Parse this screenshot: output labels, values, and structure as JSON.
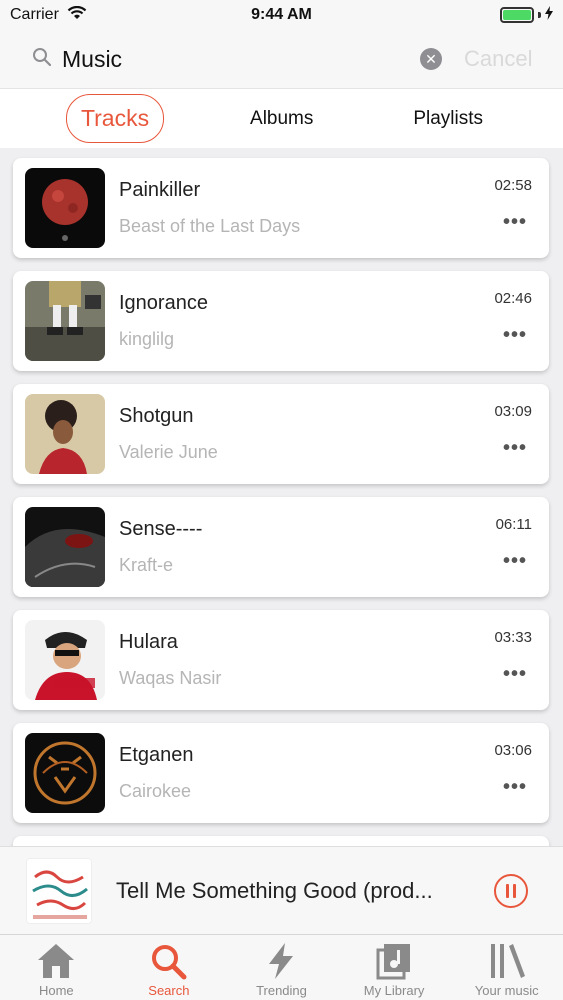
{
  "status_bar": {
    "carrier": "Carrier",
    "time": "9:44 AM"
  },
  "search": {
    "value": "Music",
    "cancel_label": "Cancel"
  },
  "tabs": [
    {
      "label": "Tracks",
      "active": true
    },
    {
      "label": "Albums",
      "active": false
    },
    {
      "label": "Playlists",
      "active": false
    }
  ],
  "tracks": [
    {
      "title": "Painkiller",
      "artist": "Beast of the Last Days",
      "duration": "02:58"
    },
    {
      "title": "Ignorance",
      "artist": "kinglilg",
      "duration": "02:46"
    },
    {
      "title": "Shotgun",
      "artist": "Valerie June",
      "duration": "03:09"
    },
    {
      "title": "Sense----",
      "artist": "Kraft-e",
      "duration": "06:11"
    },
    {
      "title": "Hulara",
      "artist": "Waqas Nasir",
      "duration": "03:33"
    },
    {
      "title": "Etganen",
      "artist": "Cairokee",
      "duration": "03:06"
    }
  ],
  "now_playing": {
    "title": "Tell Me Something Good (prod..."
  },
  "tab_bar": [
    {
      "label": "Home",
      "icon": "home-icon",
      "active": false
    },
    {
      "label": "Search",
      "icon": "search-icon",
      "active": true
    },
    {
      "label": "Trending",
      "icon": "lightning-icon",
      "active": false
    },
    {
      "label": "My Library",
      "icon": "music-library-icon",
      "active": false
    },
    {
      "label": "Your music",
      "icon": "bookshelf-icon",
      "active": false
    }
  ],
  "colors": {
    "accent": "#e8573c",
    "inactive": "#8a8a8a",
    "battery": "#4cd964"
  }
}
